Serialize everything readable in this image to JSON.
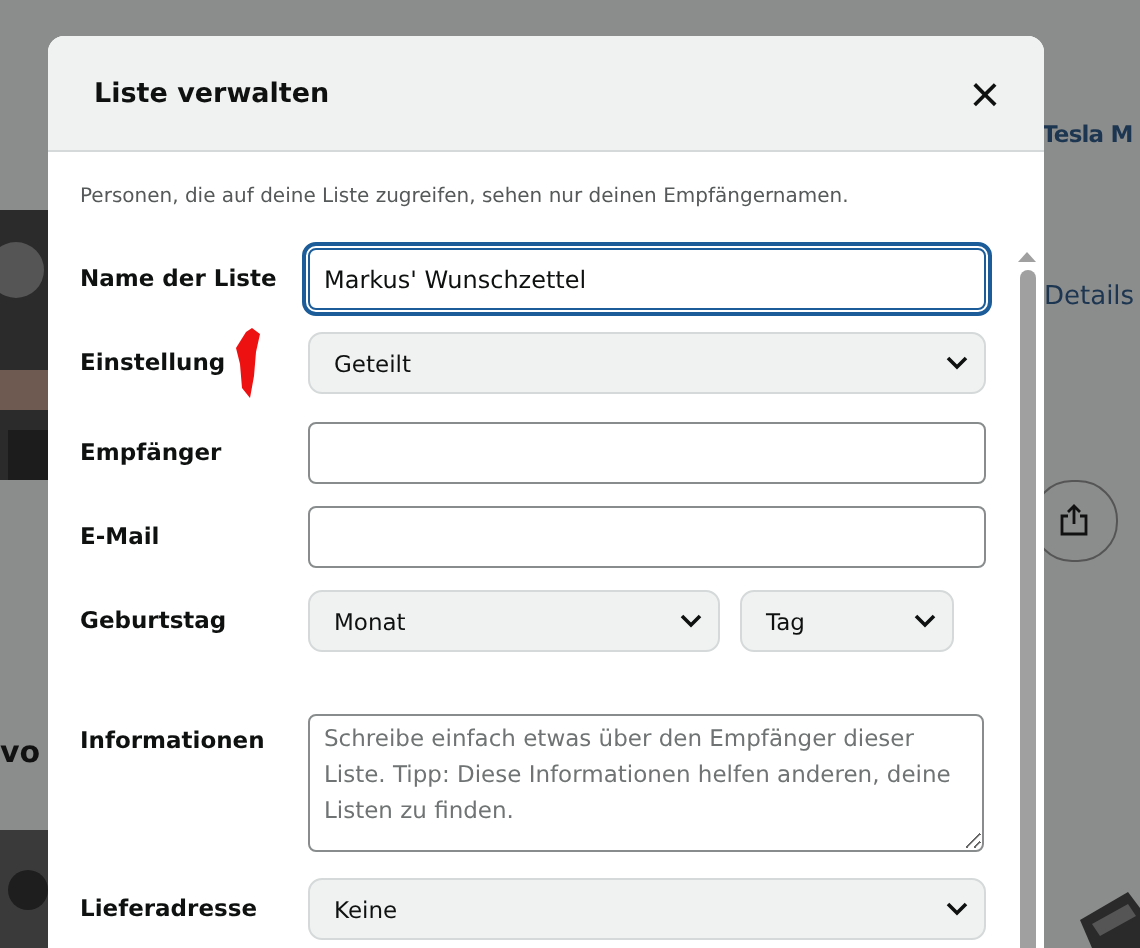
{
  "background": {
    "title": "Tesla M",
    "link": "Details",
    "heading": "vo"
  },
  "dialog": {
    "title": "Liste verwalten",
    "close": "×",
    "notice": "Personen, die auf deine Liste zugreifen, sehen nur deinen Empfängernamen.",
    "fields": [
      {
        "kind": "text",
        "label": "Name der Liste",
        "value": "Markus' Wunschzettel",
        "focused": true
      },
      {
        "kind": "select",
        "label": "Einstellung",
        "value": "Geteilt",
        "marked": true
      },
      {
        "kind": "text",
        "label": "Empfänger",
        "focused": false
      },
      {
        "kind": "text",
        "label": "E-Mail",
        "focused": false
      },
      {
        "kind": "date",
        "label": "Geburtstag",
        "month": "Monat",
        "day": "Tag"
      },
      {
        "kind": "textarea",
        "label": "Informationen",
        "placeholder": "Schreibe einfach etwas über den Empfänger dieser Liste. Tipp: Diese Informationen helfen anderen, deine Listen zu finden."
      },
      {
        "kind": "select",
        "label": "Lieferadresse",
        "value": "Keine",
        "marked": false
      }
    ]
  }
}
